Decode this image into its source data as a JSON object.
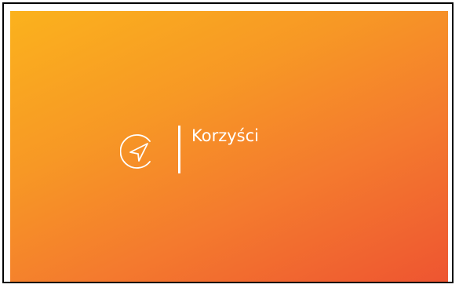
{
  "card": {
    "title": "Korzyści",
    "icon": "navigation-arrow-icon",
    "gradient_start": "#fbb21d",
    "gradient_end": "#ee5531",
    "text_color": "#ffffff"
  }
}
